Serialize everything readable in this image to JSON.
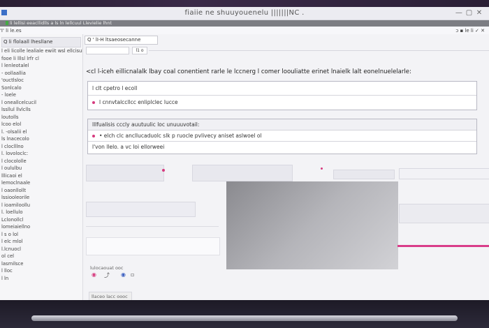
{
  "window": {
    "title": "fiaiie ne shuuyouenelu |||||||NC .",
    "buttons": [
      "—",
      "▢",
      "✕"
    ]
  },
  "tab": {
    "text": "li  lellisi eeacllidlls a ls ln lellcuul Llevielie lhnt"
  },
  "menubar": {
    "left": "'I' li  le.es",
    "right": "ɔ ▪ le li ✓ ✕"
  },
  "sidebar": {
    "header": "Q li flolaall lhesllane",
    "items": [
      "l eli licolle lealiale ewiit wsl ellcisult",
      "fooe li lllsl lrfr cl",
      "l lenleotalel",
      "- oollaallia",
      "'ouctlsloc",
      "Sonlcalo",
      "- loele",
      "l oneallcelcucil",
      "lssllul llvlclls",
      "loutolls",
      "lcoo elol",
      "l. -olsalii  el",
      "ls lnacecolo",
      "l cloclllno",
      "l. lovoloclc:",
      "l clocololle",
      "l oululbu",
      "lllicaoi el",
      "lemoclnaale",
      "l oaonllollt",
      "lssiooleorile",
      "l ioamiloollu",
      "l. loellulo",
      "Lclonollcl",
      "lomeiaiellno",
      "l s o lol",
      "l elc mlol",
      "l.lcnuocl",
      "ol cel",
      "lasmilsce",
      "l lloc",
      "l ln"
    ]
  },
  "toolbar": {
    "search_text": "Q ' lI-H  ltsaeosecanne",
    "zoom": "l1 o"
  },
  "main": {
    "heading": "<cl l‑iceh eillicnalalk lbay coal conentient rarle  le lccnerg  l comer loouliatte erinet  lnaielk  lalt eonelnuelelarle:",
    "box1": {
      "row1": "l clt cpetro l ecoll",
      "row2": "l cnnvtalccllcc enliplclec lucce"
    },
    "box2": {
      "header": "lllfualisis  cccly  auutuulic loc  unuuuvotail:",
      "row1": "•  elch clc ancllucaduolc slk p ruocle  pvlivecy aniset  aslwoel ol",
      "row2": "l'von llelo.  a  vc loi ellorweei"
    },
    "bottom": {
      "caption": "lulocaouat ooc",
      "footer_btn": "llaceo  lacc  oooc"
    }
  },
  "colors": {
    "accent": "#d93d8a",
    "bezel": "#1b1622",
    "screen": "#f3f3f6"
  }
}
